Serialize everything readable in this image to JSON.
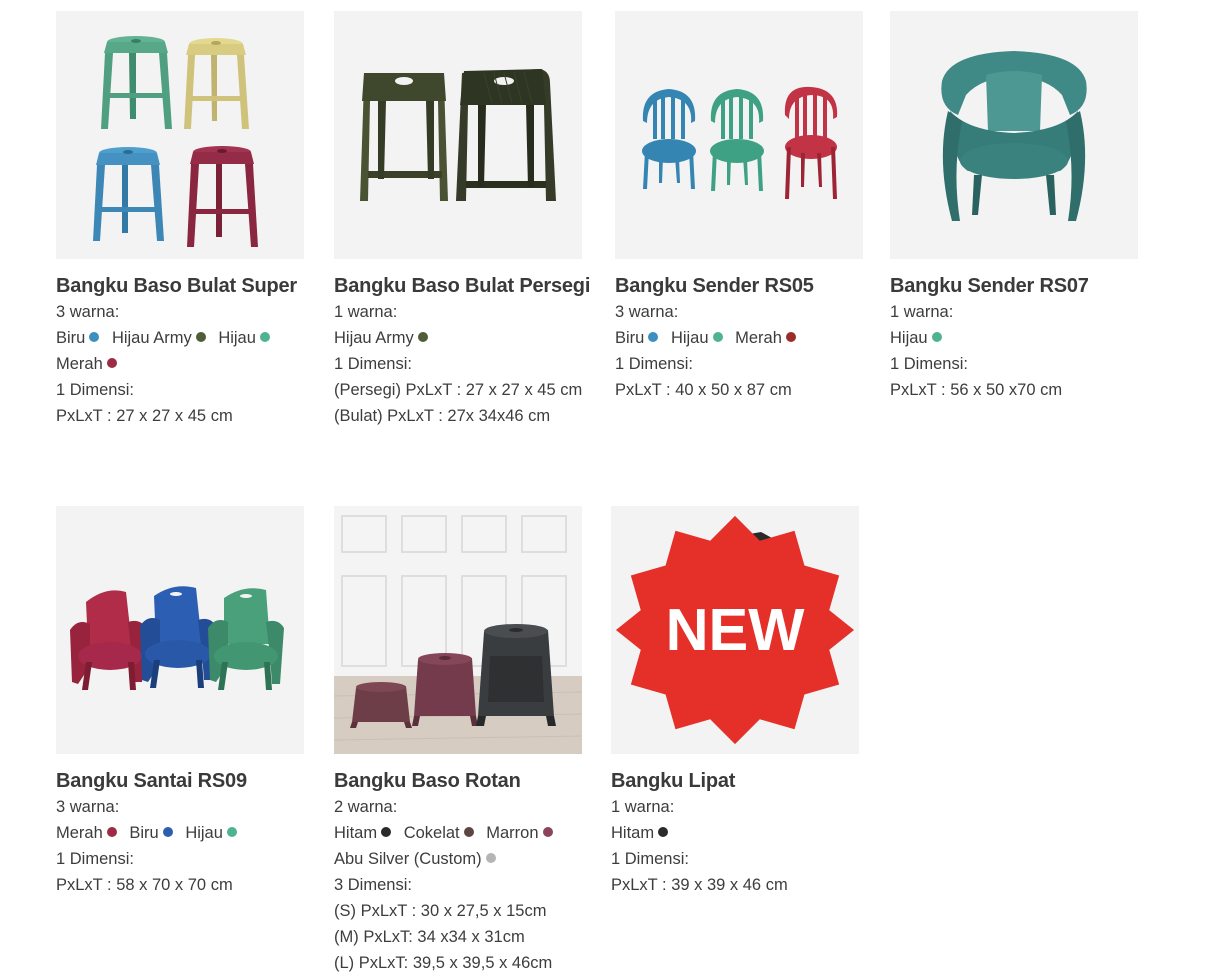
{
  "products": [
    {
      "title": "Bangku Baso Bulat Super",
      "colors_label": "3 warna:",
      "colors": [
        {
          "name": "Biru",
          "hex": "#3d8fbf"
        },
        {
          "name": "Hijau Army",
          "hex": "#4f5d38"
        },
        {
          "name": "Hijau",
          "hex": "#4fb38f"
        },
        {
          "name": "Merah",
          "hex": "#9c2c45"
        }
      ],
      "dim_label": "1 Dimensi:",
      "dims": [
        "PxLxT : 27 x 27 x 45 cm"
      ],
      "image_icon": "stools-four-colors-icon"
    },
    {
      "title": "Bangku Baso Bulat Persegi",
      "colors_label": "1 warna:",
      "colors": [
        {
          "name": "Hijau Army",
          "hex": "#4f5d38"
        }
      ],
      "dim_label": "1 Dimensi:",
      "dims": [
        "(Persegi) PxLxT : 27 x 27 x 45 cm",
        "(Bulat) PxLxT : 27x 34x46 cm"
      ],
      "image_icon": "army-stools-icon"
    },
    {
      "title": "Bangku Sender RS05",
      "colors_label": "3 warna:",
      "colors": [
        {
          "name": "Biru",
          "hex": "#3d8fbf"
        },
        {
          "name": "Hijau",
          "hex": "#4fb38f"
        },
        {
          "name": "Merah",
          "hex": "#9c2c2c"
        }
      ],
      "dim_label": "1 Dimensi:",
      "dims": [
        "PxLxT : 40 x 50 x 87 cm"
      ],
      "image_icon": "bistro-chairs-icon"
    },
    {
      "title": "Bangku Sender RS07",
      "colors_label": "1 warna:",
      "colors": [
        {
          "name": "Hijau",
          "hex": "#4fb38f"
        }
      ],
      "dim_label": "1 Dimensi:",
      "dims": [
        "PxLxT : 56 x 50 x70 cm"
      ],
      "image_icon": "armchair-icon"
    },
    {
      "title": "Bangku Santai RS09",
      "colors_label": "3 warna:",
      "colors": [
        {
          "name": "Merah",
          "hex": "#9c2c45"
        },
        {
          "name": "Biru",
          "hex": "#2b5fae"
        },
        {
          "name": "Hijau",
          "hex": "#4fb38f"
        }
      ],
      "dim_label": "1 Dimensi:",
      "dims": [
        "PxLxT : 58 x 70 x 70 cm"
      ],
      "image_icon": "lounge-chairs-icon"
    },
    {
      "title": "Bangku Baso Rotan",
      "colors_label": "2 warna:",
      "colors": [
        {
          "name": "Hitam",
          "hex": "#2a2a2a"
        },
        {
          "name": "Cokelat",
          "hex": "#5b4545"
        },
        {
          "name": "Marron",
          "hex": "#8a4658"
        },
        {
          "name": "Abu Silver (Custom)",
          "hex": "#b5b5b5"
        }
      ],
      "dim_label": "3 Dimensi:",
      "dims": [
        "(S) PxLxT : 30 x 27,5 x 15cm",
        "(M) PxLxT: 34 x34 x 31cm",
        "(L) PxLxT: 39,5 x 39,5 x 46cm"
      ],
      "image_icon": "rattan-stools-icon"
    },
    {
      "title": "Bangku Lipat",
      "colors_label": "1 warna:",
      "colors": [
        {
          "name": "Hitam",
          "hex": "#2a2a2a"
        }
      ],
      "dim_label": "1 Dimensi:",
      "dims": [
        "PxLxT : 39 x 39 x 46 cm"
      ],
      "image_icon": "folding-stool-icon",
      "badge": "NEW"
    }
  ]
}
